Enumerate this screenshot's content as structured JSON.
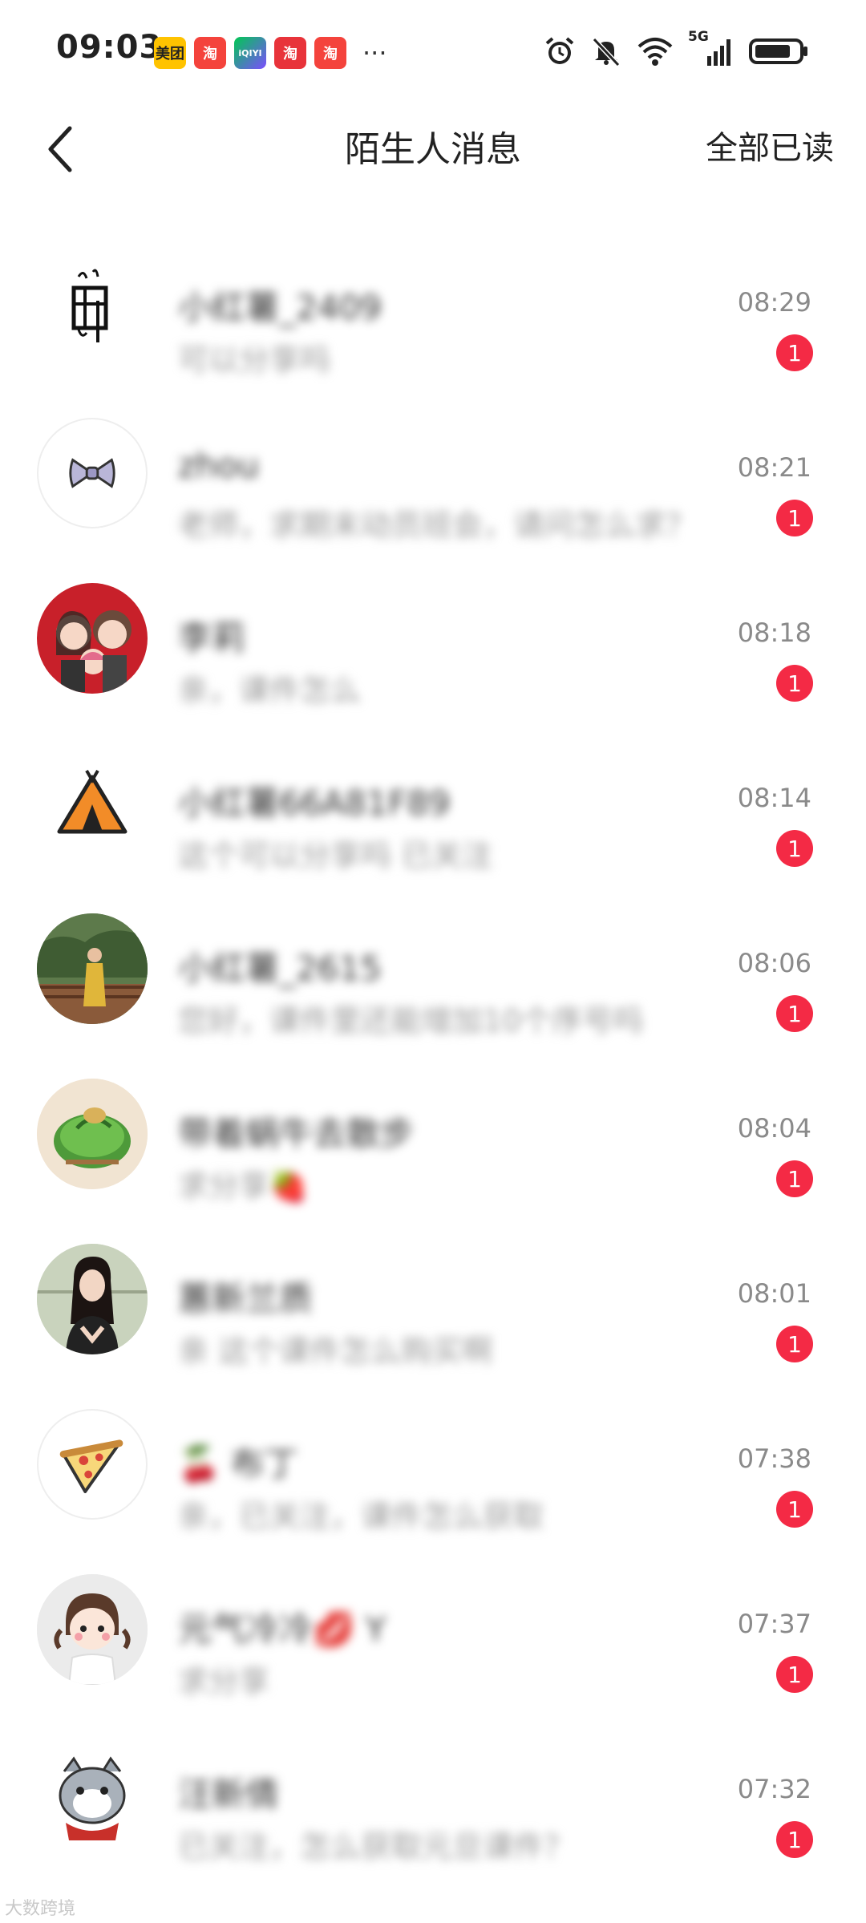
{
  "status_bar": {
    "time": "09:03",
    "apps": [
      {
        "name": "meituan",
        "label": "美团",
        "color": "#ffc300",
        "text_color": "#222"
      },
      {
        "name": "taobao",
        "label": "淘",
        "color": "#f4433c",
        "text_color": "#fff"
      },
      {
        "name": "iqiyi",
        "label": "iQIYI",
        "color": "#00c853",
        "text_color": "#fff"
      },
      {
        "name": "taobao",
        "label": "淘",
        "color": "#e8333a",
        "text_color": "#fff"
      },
      {
        "name": "taobao",
        "label": "淘",
        "color": "#f4433c",
        "text_color": "#fff"
      }
    ],
    "more": "···",
    "network": "5G",
    "battery_level": 0.8
  },
  "nav": {
    "title": "陌生人消息",
    "mark_all_read": "全部已读"
  },
  "colors": {
    "badge": "#f42a45",
    "accent": "#ff2442"
  },
  "messages": [
    {
      "name": "小红薯_2409",
      "preview": "可以分享吗",
      "time": "08:29",
      "unread": "1",
      "avatar_icon": "ink-sketch-icon"
    },
    {
      "name": "zhou",
      "preview": "老师，求期末动员班会，请问怎么求？",
      "time": "08:21",
      "unread": "1",
      "avatar_icon": "bow-icon"
    },
    {
      "name": "李莉",
      "preview": "亲，课件怎么",
      "time": "08:18",
      "unread": "1",
      "avatar_icon": "cartoon-family-icon"
    },
    {
      "name": "小红薯66A81F89",
      "preview": "这个可以分享吗 已关注",
      "time": "08:14",
      "unread": "1",
      "avatar_icon": "tent-icon"
    },
    {
      "name": "小红薯_2615",
      "preview": "您好，课件里还能增加10个序号吗",
      "time": "08:06",
      "unread": "1",
      "avatar_icon": "outdoor-photo-icon"
    },
    {
      "name": "带着蜗牛去散步",
      "preview": "求分享🍓",
      "time": "08:04",
      "unread": "1",
      "avatar_icon": "cake-icon"
    },
    {
      "name": "蕙新兰质",
      "preview": "亲 这个课件怎么购买啊",
      "time": "08:01",
      "unread": "1",
      "avatar_icon": "portrait-photo-icon"
    },
    {
      "name": "🍒 布丁",
      "preview": "亲，已关注，课件怎么获取",
      "time": "07:38",
      "unread": "1",
      "avatar_icon": "pizza-icon"
    },
    {
      "name": "元气冷冷💋 Y",
      "preview": "求分享",
      "time": "07:37",
      "unread": "1",
      "avatar_icon": "cartoon-girl-icon"
    },
    {
      "name": "汪新倩",
      "preview": "已关注，怎么获取元旦课件？",
      "time": "07:32",
      "unread": "1",
      "avatar_icon": "hamster-icon"
    }
  ],
  "watermark": "大数跨境"
}
